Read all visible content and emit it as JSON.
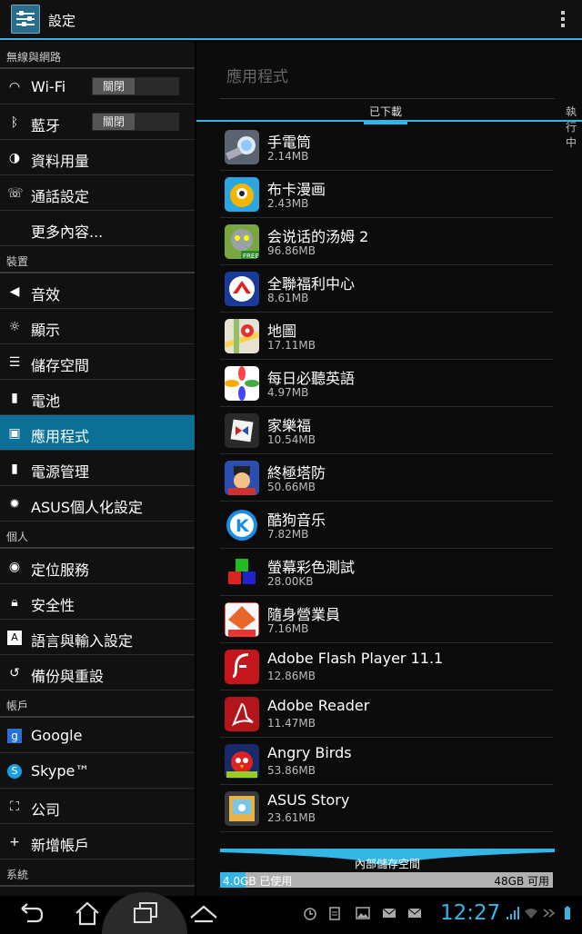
{
  "actionbar": {
    "title": "設定"
  },
  "sidebar": {
    "sections": [
      {
        "header": "無線與網路",
        "items": [
          {
            "icon": "wifi-icon",
            "label": "Wi-Fi",
            "toggle": "關閉"
          },
          {
            "icon": "bluetooth-icon",
            "label": "藍牙",
            "toggle": "關閉"
          },
          {
            "icon": "data-usage-icon",
            "label": "資料用量"
          },
          {
            "icon": "phone-icon",
            "label": "通話設定"
          },
          {
            "icon": "",
            "label": "更多內容..."
          }
        ]
      },
      {
        "header": "裝置",
        "items": [
          {
            "icon": "sound-icon",
            "label": "音效"
          },
          {
            "icon": "display-icon",
            "label": "顯示"
          },
          {
            "icon": "storage-icon",
            "label": "儲存空間"
          },
          {
            "icon": "battery-icon",
            "label": "電池"
          },
          {
            "icon": "apps-icon",
            "label": "應用程式",
            "active": true
          },
          {
            "icon": "power-icon",
            "label": "電源管理"
          },
          {
            "icon": "gear-icon",
            "label": "ASUS個人化設定"
          }
        ]
      },
      {
        "header": "個人",
        "items": [
          {
            "icon": "location-icon",
            "label": "定位服務"
          },
          {
            "icon": "lock-icon",
            "label": "安全性"
          },
          {
            "icon": "language-icon",
            "label": "語言與輸入設定"
          },
          {
            "icon": "backup-icon",
            "label": "備份與重設"
          }
        ]
      },
      {
        "header": "帳戶",
        "items": [
          {
            "icon": "google-icon",
            "label": "Google"
          },
          {
            "icon": "skype-icon",
            "label": "Skype™"
          },
          {
            "icon": "company-icon",
            "label": "公司"
          },
          {
            "icon": "add-icon",
            "label": "新增帳戶"
          }
        ]
      },
      {
        "header": "系統",
        "items": []
      }
    ]
  },
  "panel": {
    "title": "應用程式",
    "tabs": {
      "downloaded": "已下載",
      "running": "執行中"
    },
    "apps": [
      {
        "name": "手電筒",
        "size": "2.14MB",
        "icon": "flashlight-icon"
      },
      {
        "name": "布卡漫画",
        "size": "2.43MB",
        "icon": "buka-icon"
      },
      {
        "name": "会说话的汤姆 2",
        "size": "96.86MB",
        "icon": "talking-tom-icon"
      },
      {
        "name": "全聯福利中心",
        "size": "8.61MB",
        "icon": "pxmart-icon"
      },
      {
        "name": "地圖",
        "size": "17.11MB",
        "icon": "maps-icon"
      },
      {
        "name": "每日必聽英語",
        "size": "4.97MB",
        "icon": "english-icon"
      },
      {
        "name": "家樂福",
        "size": "10.54MB",
        "icon": "carrefour-icon"
      },
      {
        "name": "終極塔防",
        "size": "50.66MB",
        "icon": "tower-defense-icon"
      },
      {
        "name": "酷狗音乐",
        "size": "7.82MB",
        "icon": "kugou-icon"
      },
      {
        "name": "螢幕彩色測試",
        "size": "28.00KB",
        "icon": "color-test-icon"
      },
      {
        "name": "隨身營業員",
        "size": "7.16MB",
        "icon": "broker-icon"
      },
      {
        "name": "Adobe Flash Player 11.1",
        "size": "12.86MB",
        "icon": "flash-icon"
      },
      {
        "name": "Adobe Reader",
        "size": "11.47MB",
        "icon": "adobe-reader-icon"
      },
      {
        "name": "Angry Birds",
        "size": "53.86MB",
        "icon": "angry-birds-icon"
      },
      {
        "name": "ASUS Story",
        "size": "23.61MB",
        "icon": "asus-story-icon"
      }
    ],
    "storage": {
      "label": "內部儲存空間",
      "used": "4.0GB 已使用",
      "free": "48GB 可用",
      "used_fraction": 0.077
    }
  },
  "status": {
    "time": "12:27"
  }
}
